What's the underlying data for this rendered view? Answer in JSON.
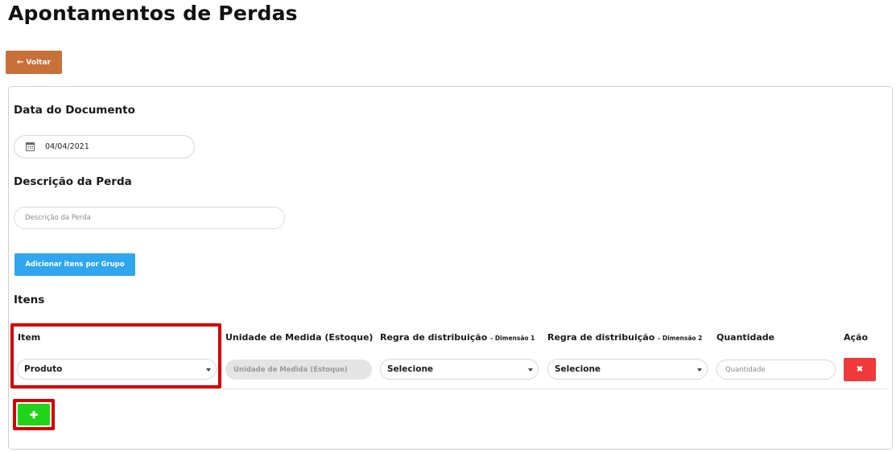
{
  "page": {
    "title": "Apontamentos de Perdas",
    "back_label": "Voltar"
  },
  "document": {
    "date_label": "Data do Documento",
    "date_value": "04/04/2021",
    "description_label": "Descrição da Perda",
    "description_placeholder": "Descrição da Perda",
    "description_value": "",
    "group_button_label": "Adicionar itens por Grupo"
  },
  "items": {
    "section_label": "Itens",
    "columns": {
      "item": "Item",
      "unit": "Unidade de Medida (Estoque)",
      "rule1": "Regra de distribuição",
      "rule1_sub": "- Dimensão 1",
      "rule2": "Regra de distribuição",
      "rule2_sub": "- Dimensão 2",
      "quantity": "Quantidade",
      "action": "Ação"
    },
    "rows": [
      {
        "item_value": "Produto",
        "unit_placeholder": "Unidade de Medida (Estoque)",
        "rule1_value": "Selecione",
        "rule2_value": "Selecione",
        "quantity_placeholder": "Quantidade",
        "delete_symbol": "✖"
      }
    ],
    "add_symbol": "✚"
  },
  "colors": {
    "back_button": "#c8703a",
    "group_button": "#2fa6ef",
    "delete_button": "#f0393a",
    "add_button": "#22d419",
    "highlight": "#d60000"
  }
}
